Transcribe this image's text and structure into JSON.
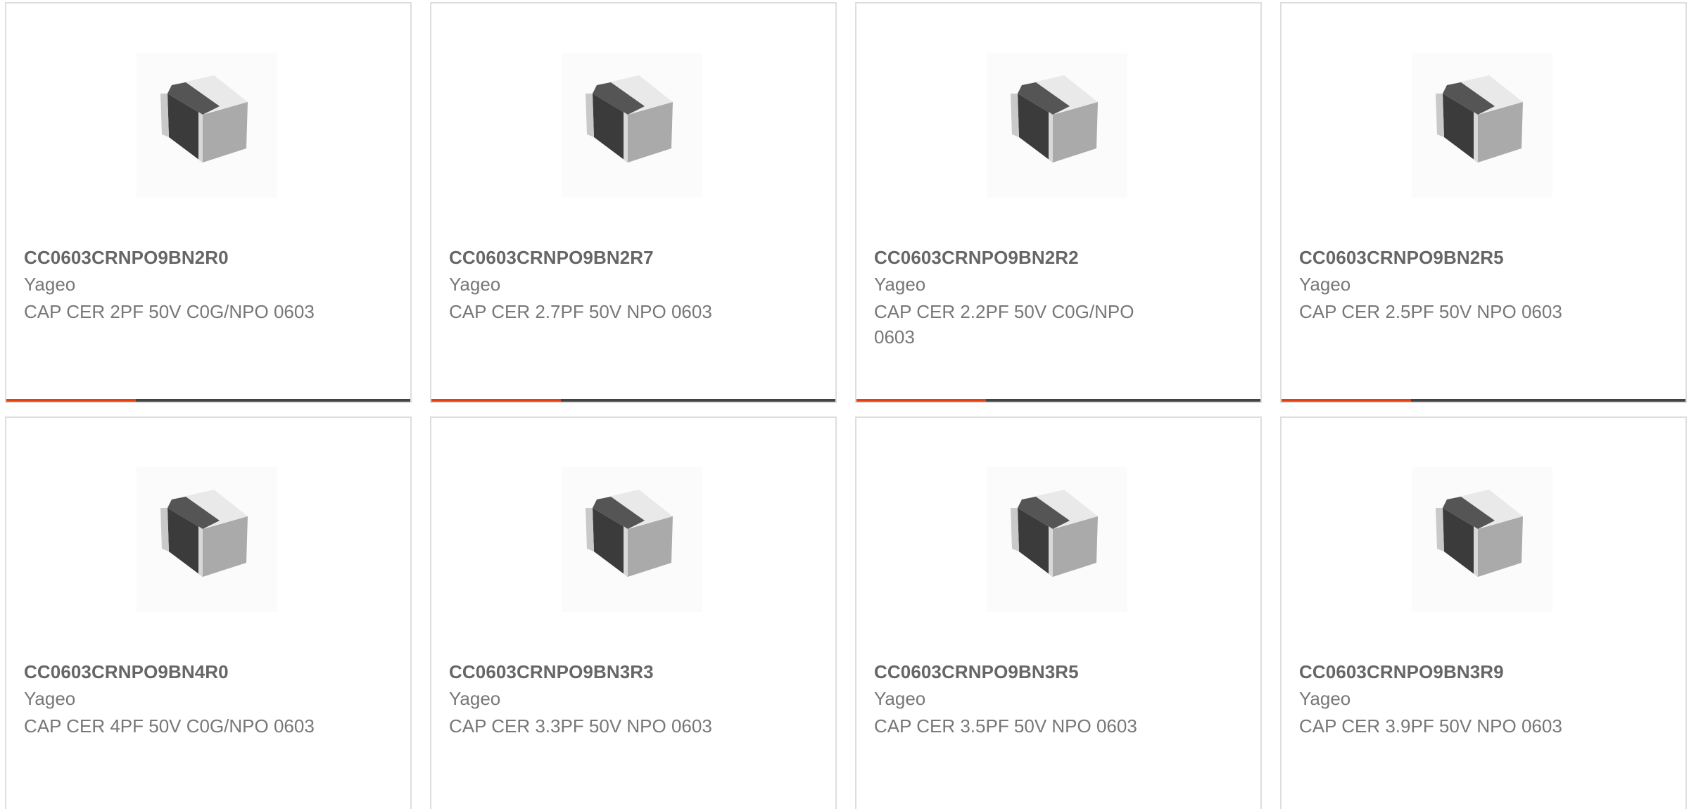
{
  "colors": {
    "accent": "#e8400c",
    "track": "#444444",
    "border": "#dedede"
  },
  "product_image_icon": "capacitor-chip-icon",
  "cards": [
    {
      "part": "CC0603CRNPO9BN2R0",
      "maker": "Yageo",
      "description": "CAP CER 2PF 50V C0G/NPO 0603",
      "progress_fraction": 0.32
    },
    {
      "part": "CC0603CRNPO9BN2R7",
      "maker": "Yageo",
      "description": "CAP CER 2.7PF 50V NPO 0603",
      "progress_fraction": 0.32
    },
    {
      "part": "CC0603CRNPO9BN2R2",
      "maker": "Yageo",
      "description": "CAP CER 2.2PF 50V C0G/NPO 0603",
      "progress_fraction": 0.32
    },
    {
      "part": "CC0603CRNPO9BN2R5",
      "maker": "Yageo",
      "description": "CAP CER 2.5PF 50V NPO 0603",
      "progress_fraction": 0.32
    },
    {
      "part": "CC0603CRNPO9BN4R0",
      "maker": "Yageo",
      "description": "CAP CER 4PF 50V C0G/NPO 0603"
    },
    {
      "part": "CC0603CRNPO9BN3R3",
      "maker": "Yageo",
      "description": "CAP CER 3.3PF 50V NPO 0603"
    },
    {
      "part": "CC0603CRNPO9BN3R5",
      "maker": "Yageo",
      "description": "CAP CER 3.5PF 50V NPO 0603"
    },
    {
      "part": "CC0603CRNPO9BN3R9",
      "maker": "Yageo",
      "description": "CAP CER 3.9PF 50V NPO 0603"
    }
  ]
}
